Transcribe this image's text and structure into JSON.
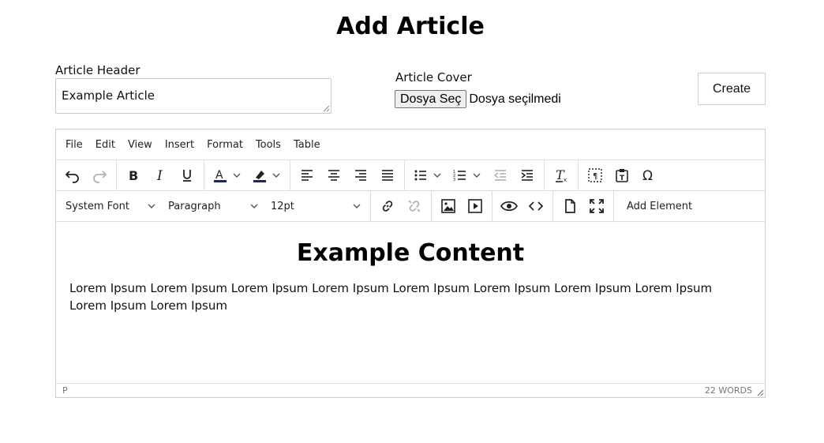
{
  "page": {
    "title": "Add Article"
  },
  "form": {
    "header_label": "Article Header",
    "header_value": "Example Article",
    "cover_label": "Article Cover",
    "file_button": "Dosya Seç",
    "file_status": "Dosya seçilmedi",
    "create_label": "Create"
  },
  "editor": {
    "menus": [
      "File",
      "Edit",
      "View",
      "Insert",
      "Format",
      "Tools",
      "Table"
    ],
    "font_family": "System Font",
    "block_format": "Paragraph",
    "font_size": "12pt",
    "add_element": "Add Element",
    "content": {
      "heading": "Example Content",
      "paragraph": "Lorem Ipsum Lorem Ipsum Lorem Ipsum Lorem Ipsum Lorem Ipsum Lorem Ipsum Lorem Ipsum Lorem Ipsum Lorem Ipsum Lorem Ipsum"
    },
    "status": {
      "path": "P",
      "word_count": "22 WORDS"
    }
  }
}
